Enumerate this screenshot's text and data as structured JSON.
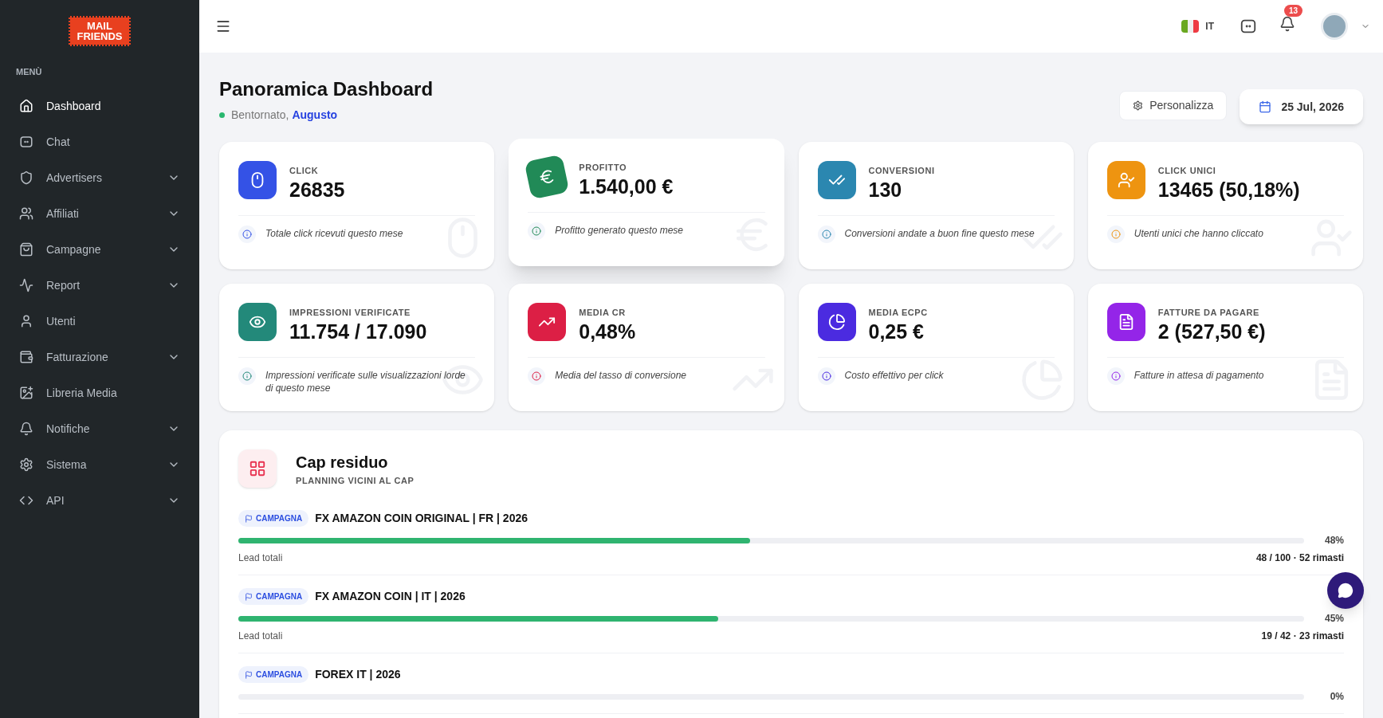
{
  "sidebar": {
    "logo": {
      "line1": "MAIL",
      "line2": "FRIENDS"
    },
    "section_title": "MENÙ",
    "items": [
      {
        "label": "Dashboard",
        "selected": true,
        "has_submenu": false
      },
      {
        "label": "Chat",
        "selected": false,
        "has_submenu": false
      },
      {
        "label": "Advertisers",
        "selected": false,
        "has_submenu": true
      },
      {
        "label": "Affiliati",
        "selected": false,
        "has_submenu": true
      },
      {
        "label": "Campagne",
        "selected": false,
        "has_submenu": true
      },
      {
        "label": "Report",
        "selected": false,
        "has_submenu": true
      },
      {
        "label": "Utenti",
        "selected": false,
        "has_submenu": false
      },
      {
        "label": "Fatturazione",
        "selected": false,
        "has_submenu": true
      },
      {
        "label": "Libreria Media",
        "selected": false,
        "has_submenu": false
      },
      {
        "label": "Notifiche",
        "selected": false,
        "has_submenu": true
      },
      {
        "label": "Sistema",
        "selected": false,
        "has_submenu": true
      },
      {
        "label": "API",
        "selected": false,
        "has_submenu": true
      }
    ]
  },
  "header": {
    "language": "IT",
    "notifications_count": "13"
  },
  "page": {
    "title": "Panoramica Dashboard",
    "greeting": "Bentornato,",
    "user_name": "Augusto",
    "customize_button": "Personalizza",
    "date": "25 Jul, 2026"
  },
  "stat_cards": [
    {
      "label": "CLICK",
      "value": "26835",
      "note": "Totale click ricevuti questo mese",
      "color": "#3452e6",
      "raised": false
    },
    {
      "label": "PROFITTO",
      "value": "1.540,00 €",
      "note": "Profitto generato questo mese",
      "color": "#218a57",
      "raised": true
    },
    {
      "label": "CONVERSIONI",
      "value": "130",
      "note": "Conversioni andate a buon fine questo mese",
      "color": "#2b87b0",
      "raised": false
    },
    {
      "label": "CLICK UNICI",
      "value": "13465 (50,18%)",
      "note": "Utenti unici che hanno cliccato",
      "color": "#ee9410",
      "raised": false
    },
    {
      "label": "IMPRESSIONI VERIFICATE",
      "value": "11.754 / 17.090",
      "note": "Impressioni verificate sulle visualizzazioni lorde di questo mese",
      "color": "#23897a",
      "raised": false
    },
    {
      "label": "MEDIA CR",
      "value": "0,48%",
      "note": "Media del tasso di conversione",
      "color": "#dc1f45",
      "raised": false
    },
    {
      "label": "MEDIA ECPC",
      "value": "0,25 €",
      "note": "Costo effettivo per click",
      "color": "#4b2be0",
      "raised": false
    },
    {
      "label": "FATTURE DA PAGARE",
      "value": "2 (527,50 €)",
      "note": "Fatture in attesa di pagamento",
      "color": "#9425e8",
      "raised": false
    }
  ],
  "cap_section": {
    "title": "Cap residuo",
    "subtitle": "PLANNING VICINI AL CAP",
    "rows": [
      {
        "tag": "CAMPAGNA",
        "name": "FX AMAZON COIN ORIGINAL | FR | 2026",
        "level": 0.48,
        "percent": "48%",
        "caption": "Lead totali",
        "detail": "48 / 100 · 52 rimasti"
      },
      {
        "tag": "CAMPAGNA",
        "name": "FX AMAZON COIN | IT | 2026",
        "level": 0.45,
        "percent": "45%",
        "caption": "Lead totali",
        "detail": "19 / 42 · 23 rimasti"
      },
      {
        "tag": "CAMPAGNA",
        "name": "FOREX IT | 2026",
        "level": 0,
        "percent": "0%"
      }
    ]
  }
}
